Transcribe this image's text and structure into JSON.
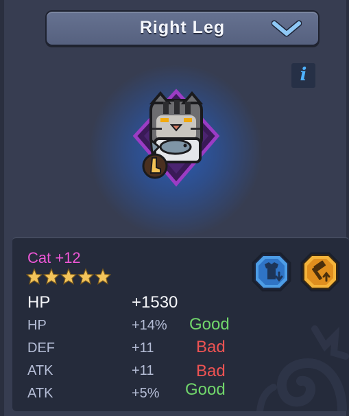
{
  "header": {
    "title": "Right Leg",
    "dropdown_icon": "chevron-down-icon"
  },
  "info_button": {
    "label": "i"
  },
  "item": {
    "name": "Cat +12",
    "stars": 5,
    "icon": "cat-holding-fish-icon",
    "slot_icon": "leg-icon",
    "rarity_color": "#9b3cc4"
  },
  "actions": {
    "equip_icon": "armor-down-icon",
    "forge_icon": "hammer-up-icon"
  },
  "main_stat": {
    "name": "HP",
    "value": "+1530"
  },
  "sub_stats": [
    {
      "name": "HP",
      "value": "+14%",
      "grade": "Good",
      "grade_color": "#71d66b"
    },
    {
      "name": "DEF",
      "value": "+11",
      "grade": "Bad",
      "grade_color": "#f05353"
    },
    {
      "name": "ATK",
      "value": "+11",
      "grade": "Bad",
      "grade_color": "#f05353"
    },
    {
      "name": "ATK",
      "value": "+5%",
      "grade": "Good",
      "grade_color": "#71d66b"
    }
  ],
  "colors": {
    "item_name": "#ee57d7",
    "star": "#f3c45b",
    "background": "#373d51",
    "panel": "#252b3b"
  }
}
